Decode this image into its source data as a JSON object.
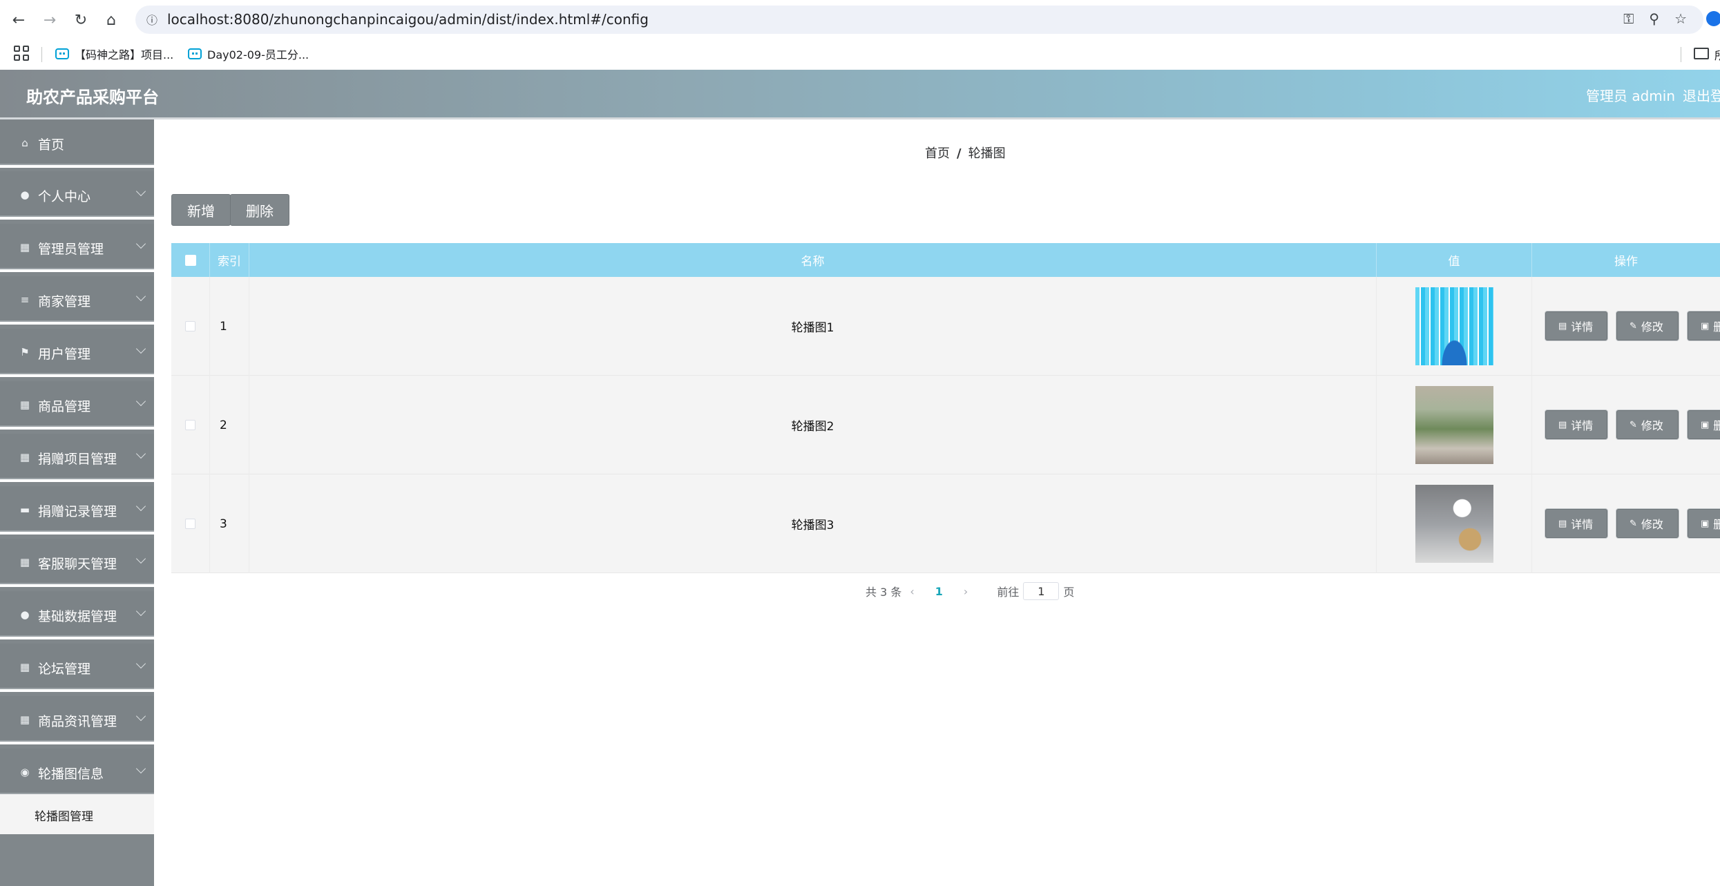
{
  "browser": {
    "url": "localhost:8080/zhunongchanpincaigou/admin/dist/index.html#/config",
    "bookmarks": [
      {
        "label": "【码神之路】项目..."
      },
      {
        "label": "Day02-09-员工分..."
      }
    ],
    "bookmark_folder_label": "所"
  },
  "header": {
    "title": "助农产品采购平台",
    "admin_label": "管理员 admin",
    "logout_label": "退出登"
  },
  "sidebar": {
    "items": [
      {
        "label": "首页",
        "icon": "home-icon"
      },
      {
        "label": "个人中心",
        "icon": "user-icon"
      },
      {
        "label": "管理员管理",
        "icon": "grid-icon"
      },
      {
        "label": "商家管理",
        "icon": "menu-icon"
      },
      {
        "label": "用户管理",
        "icon": "flag-icon"
      },
      {
        "label": "商品管理",
        "icon": "grid-icon"
      },
      {
        "label": "捐赠项目管理",
        "icon": "grid-icon"
      },
      {
        "label": "捐赠记录管理",
        "icon": "ticket-icon"
      },
      {
        "label": "客服聊天管理",
        "icon": "grid-icon"
      },
      {
        "label": "基础数据管理",
        "icon": "user-icon"
      },
      {
        "label": "论坛管理",
        "icon": "grid-icon"
      },
      {
        "label": "商品资讯管理",
        "icon": "grid-icon"
      },
      {
        "label": "轮播图信息",
        "icon": "location-icon"
      }
    ],
    "submenu_item": "轮播图管理"
  },
  "breadcrumb": {
    "home": "首页",
    "separator": "/",
    "current": "轮播图"
  },
  "toolbar": {
    "add_label": "新增",
    "delete_label": "删除"
  },
  "table": {
    "headers": {
      "index": "索引",
      "name": "名称",
      "value": "值",
      "ops": "操作"
    },
    "rows": [
      {
        "index": "1",
        "name": "轮播图1"
      },
      {
        "index": "2",
        "name": "轮播图2"
      },
      {
        "index": "3",
        "name": "轮播图3"
      }
    ],
    "actions": {
      "detail": "详情",
      "edit": "修改",
      "delete": "删除"
    }
  },
  "pagination": {
    "total_label": "共 3 条",
    "current_page": "1",
    "goto_label": "前往",
    "goto_value": "1",
    "page_suffix": "页"
  }
}
